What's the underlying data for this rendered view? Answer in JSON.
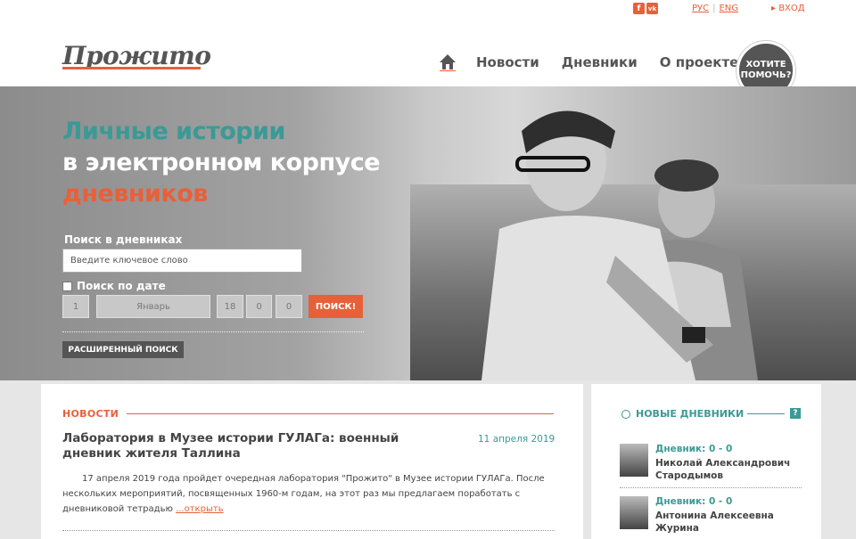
{
  "topbar": {
    "social": [
      {
        "icon": "facebook-icon",
        "glyph": "f"
      },
      {
        "icon": "vk-icon",
        "glyph": "vk"
      }
    ],
    "lang_ru": "РУС",
    "lang_en": "ENG",
    "login": "▸ ВХОД"
  },
  "header": {
    "logo": "Прожито",
    "nav": [
      "Новости",
      "Дневники",
      "О проекте"
    ],
    "help_button": "ХОТИТЕ ПОМОЧЬ?"
  },
  "hero": {
    "line1": "Личные истории",
    "line2": "в электронном корпусе",
    "line3": "дневников",
    "search_label": "Поиск в дневниках",
    "search_placeholder": "Введите ключевое слово",
    "date_search_label": "Поиск по дате",
    "date_day": "1",
    "date_month": "Январь",
    "date_year": [
      "18",
      "0",
      "0"
    ],
    "search_button": "ПОИСК!",
    "advanced_search": "РАСШИРЕННЫЙ ПОИСК"
  },
  "news": {
    "heading": "НОВОСТИ",
    "title": "Лаборатория в Музее истории ГУЛАГа: военный дневник жителя Таллина",
    "date": "11 апреля 2019",
    "text": "17 апреля 2019 года пройдет очередная лаборатория \"Прожито\" в Музее истории ГУЛАГа. После нескольких мероприятий, посвященных 1960-м годам, на этот раз мы предлагаем поработать с дневниковой тетрадью",
    "more": "...открыть"
  },
  "new_diaries": {
    "heading": "НОВЫЕ ДНЕВНИКИ",
    "help_icon": "?",
    "items": [
      {
        "label": "Дневник: 0 - 0",
        "name": "Николай Александрович Стародымов"
      },
      {
        "label": "Дневник: 0 - 0",
        "name": "Антонина Алексеевна Журина"
      }
    ]
  },
  "colors": {
    "accent": "#e8603a",
    "teal": "#3a9a96",
    "dark": "#555555"
  }
}
